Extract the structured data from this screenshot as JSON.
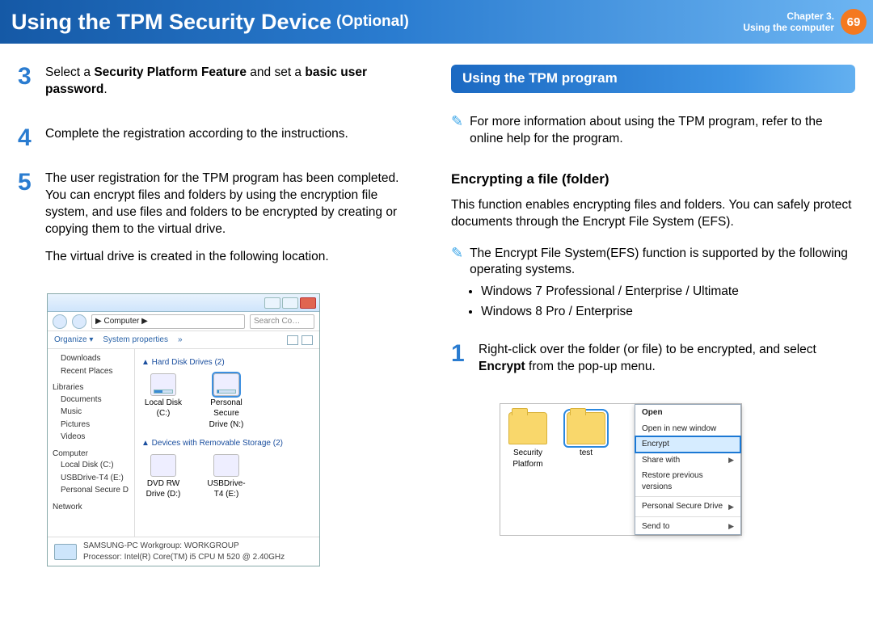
{
  "header": {
    "title": "Using the TPM Security Device",
    "optional": "(Optional)",
    "chapter_line1": "Chapter 3.",
    "chapter_line2": "Using the computer",
    "page": "69"
  },
  "left": {
    "step3_a": "Select a ",
    "step3_b": "Security Platform Feature",
    "step3_c": " and set a ",
    "step3_d": "basic user password",
    "step3_e": ".",
    "step4": "Complete the registration according to the instructions.",
    "step5_p1": "The user registration for the TPM program has been completed. You can encrypt files and folders by using the encryption file system, and use files and folders to be encrypted by creating or copying them to the virtual drive.",
    "step5_p2": "The virtual drive is created in the following location."
  },
  "explorer": {
    "path": "▶ Computer ▶",
    "search_ph": "Search Co…",
    "organize": "Organize ▾",
    "sysprops": "System properties",
    "more": "»",
    "tree": {
      "downloads": "Downloads",
      "recent": "Recent Places",
      "libraries": "Libraries",
      "documents": "Documents",
      "music": "Music",
      "pictures": "Pictures",
      "videos": "Videos",
      "computer": "Computer",
      "localc": "Local Disk (C:)",
      "usbt4": "USBDrive-T4 (E:)",
      "psd": "Personal Secure D",
      "network": "Network"
    },
    "sect_hdd": "▲ Hard Disk Drives (2)",
    "drive_local": "Local Disk (C:)",
    "drive_psd": "Personal Secure Drive (N:)",
    "sect_rem": "▲ Devices with Removable Storage (2)",
    "drive_dvd": "DVD RW Drive (D:)",
    "drive_usb": "USBDrive-T4 (E:)",
    "status_line1": "SAMSUNG-PC   Workgroup:  WORKGROUP",
    "status_line2": "Processor:  Intel(R) Core(TM) i5 CPU      M 520  @ 2.40GHz"
  },
  "right": {
    "banner": "Using the TPM program",
    "note1": "For more information about using the TPM program, refer to the online help for the program.",
    "subhead": "Encrypting a file (folder)",
    "intro": "This function enables encrypting files and folders. You can safely protect documents through the Encrypt File System (EFS).",
    "note2_lead": "The Encrypt File System(EFS) function is supported by the following operating systems.",
    "note2_li1": "Windows 7 Professional / Enterprise / Ultimate",
    "note2_li2": "Windows 8 Pro / Enterprise",
    "step1_a": "Right-click over the folder (or file) to be encrypted, and select ",
    "step1_b": "Encrypt",
    "step1_c": " from the pop-up menu."
  },
  "ctx": {
    "folder1": "Security Platform",
    "folder2": "test",
    "open": "Open",
    "open_new": "Open in new window",
    "encrypt": "Encrypt",
    "share": "Share with",
    "restore": "Restore previous versions",
    "psd": "Personal Secure Drive",
    "sendto": "Send to"
  }
}
